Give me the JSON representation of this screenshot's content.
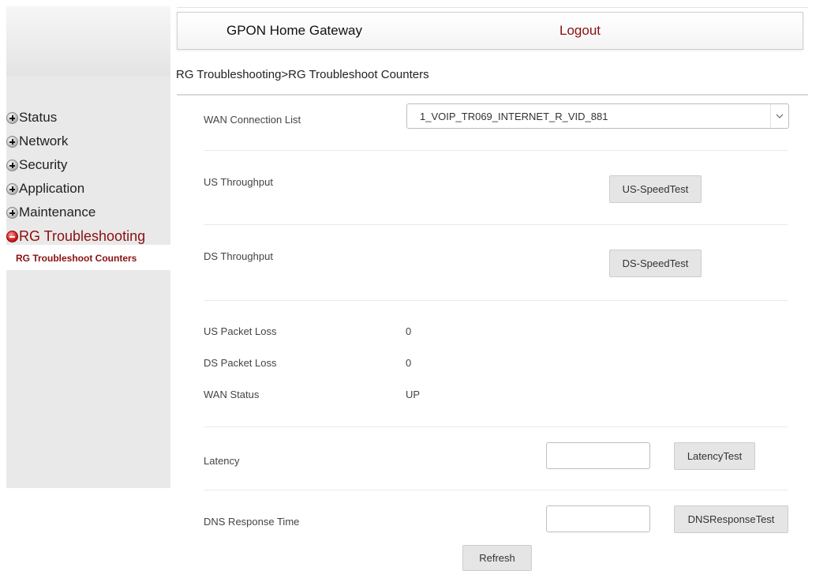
{
  "header": {
    "title": "GPON Home Gateway",
    "logout_label": "Logout"
  },
  "breadcrumb": "RG Troubleshooting>RG Troubleshoot Counters",
  "sidebar": {
    "items": [
      {
        "label": "Status",
        "icon": "expand-plus-icon"
      },
      {
        "label": "Network",
        "icon": "expand-plus-icon"
      },
      {
        "label": "Security",
        "icon": "expand-plus-icon"
      },
      {
        "label": "Application",
        "icon": "expand-plus-icon"
      },
      {
        "label": "Maintenance",
        "icon": "expand-plus-icon"
      },
      {
        "label": "RG Troubleshooting",
        "icon": "collapse-minus-icon"
      }
    ],
    "subitem": "RG Troubleshoot Counters"
  },
  "form": {
    "wan_connection_label": "WAN Connection List",
    "wan_connection_value": "1_VOIP_TR069_INTERNET_R_VID_881",
    "us_throughput_label": "US Throughput",
    "us_speedtest_button": "US-SpeedTest",
    "ds_throughput_label": "DS Throughput",
    "ds_speedtest_button": "DS-SpeedTest",
    "us_packet_loss_label": "US Packet Loss",
    "us_packet_loss_value": "0",
    "ds_packet_loss_label": "DS Packet Loss",
    "ds_packet_loss_value": "0",
    "wan_status_label": "WAN Status",
    "wan_status_value": "UP",
    "latency_label": "Latency",
    "latency_value": "",
    "latency_button": "LatencyTest",
    "dns_label": "DNS Response Time",
    "dns_value": "",
    "dns_button": "DNSResponseTest",
    "refresh_button": "Refresh"
  },
  "colors": {
    "accent": "#8a1010",
    "sidebar_bg": "#e9e9e9",
    "button_bg": "#e5e5e5"
  }
}
